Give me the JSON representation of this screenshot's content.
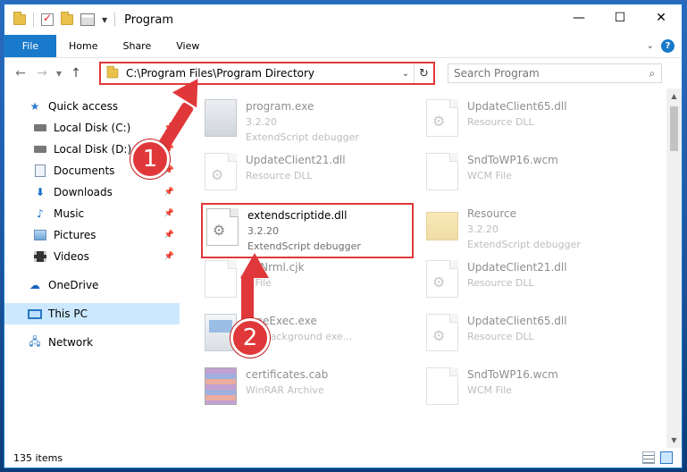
{
  "window": {
    "title": "Program",
    "controls": {
      "minimize": "—",
      "maximize": "☐",
      "close": "✕"
    }
  },
  "ribbon": {
    "tabs": [
      "File",
      "Home",
      "Share",
      "View"
    ],
    "help": "?"
  },
  "address": {
    "path": "C:\\Program Files\\Program Directory",
    "search_placeholder": "Search Program"
  },
  "sidebar": {
    "items": [
      {
        "label": "Quick access",
        "icon": "star-icon"
      },
      {
        "label": "Local Disk (C:)",
        "icon": "drive-icon",
        "pinned": true
      },
      {
        "label": "Local Disk (D:)",
        "icon": "drive-icon",
        "pinned": true
      },
      {
        "label": "Documents",
        "icon": "documents-icon",
        "pinned": true
      },
      {
        "label": "Downloads",
        "icon": "downloads-icon",
        "pinned": true
      },
      {
        "label": "Music",
        "icon": "music-icon",
        "pinned": true
      },
      {
        "label": "Pictures",
        "icon": "pictures-icon",
        "pinned": true
      },
      {
        "label": "Videos",
        "icon": "videos-icon",
        "pinned": true
      },
      {
        "label": "OneDrive",
        "icon": "onedrive-icon"
      },
      {
        "label": "This PC",
        "icon": "this-pc-icon",
        "selected": true
      },
      {
        "label": "Network",
        "icon": "network-icon"
      }
    ]
  },
  "files": [
    {
      "name": "program.exe",
      "line2": "3.2.20",
      "line3": "ExtendScript debugger",
      "icon": "program-icon"
    },
    {
      "name": "UpdateClient65.dll",
      "line2": "Resource DLL",
      "line3": "",
      "icon": "dll-icon"
    },
    {
      "name": "UpdateClient21.dll",
      "line2": "Resource DLL",
      "line3": "",
      "icon": "dll-icon"
    },
    {
      "name": "SndToWP16.wcm",
      "line2": "WCM File",
      "line3": "",
      "icon": "file-icon"
    },
    {
      "name": "extendscriptide.dll",
      "line2": "3.2.20",
      "line3": "ExtendScript debugger",
      "icon": "dll-icon",
      "highlighted": true
    },
    {
      "name": "Resource",
      "line2": "3.2.20",
      "line3": "ExtendScript debugger",
      "icon": "folder-icon"
    },
    {
      "name": "...tNrml.cjk",
      "line2": "...File",
      "line3": "",
      "icon": "file-icon"
    },
    {
      "name": "UpdateClient21.dll",
      "line2": "Resource DLL",
      "line3": "",
      "icon": "dll-icon"
    },
    {
      "name": "...neExec.exe",
      "line2": "...Y background exe...",
      "line3": "",
      "icon": "exe-icon"
    },
    {
      "name": "UpdateClient65.dll",
      "line2": "Resource DLL",
      "line3": "",
      "icon": "dll-icon"
    },
    {
      "name": "certificates.cab",
      "line2": "WinRAR Archive",
      "line3": "",
      "icon": "archive-icon"
    },
    {
      "name": "SndToWP16.wcm",
      "line2": "WCM File",
      "line3": "",
      "icon": "file-icon"
    }
  ],
  "status": {
    "count": "135 items"
  },
  "annotations": {
    "step1": "1",
    "step2": "2"
  },
  "colors": {
    "accent": "#1979ca",
    "annotation": "#e0383a",
    "selected": "#cce8ff"
  }
}
